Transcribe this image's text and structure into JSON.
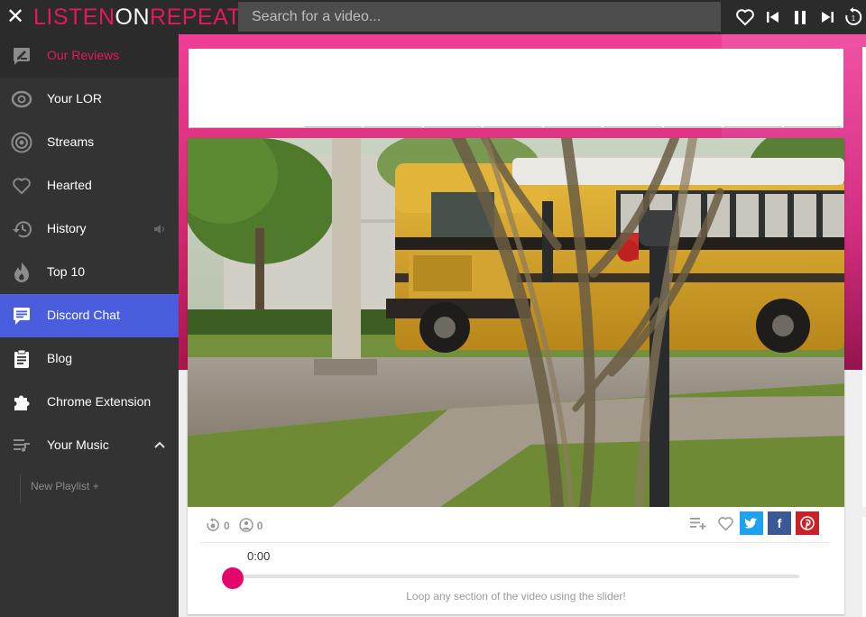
{
  "app": {
    "logo_left": "LISTEN",
    "logo_on": "ON",
    "logo_right": "REPEAT",
    "close_icon": "close-icon",
    "brand_color": "#e4185c"
  },
  "search": {
    "placeholder": "Search for a video..."
  },
  "toolbar": {
    "icons": [
      "heart-icon",
      "skip-previous-icon",
      "pause-icon",
      "skip-next-icon",
      "replay-icon"
    ],
    "replay_badge": "1"
  },
  "sidebar": {
    "items": [
      {
        "label": "Our Reviews",
        "icon": "rate-review-icon",
        "active": true
      },
      {
        "label": "Your LOR",
        "icon": "lor-logo-icon"
      },
      {
        "label": "Streams",
        "icon": "streams-icon"
      },
      {
        "label": "Hearted",
        "icon": "heart-icon"
      },
      {
        "label": "History",
        "icon": "history-icon",
        "extra": "volume-icon"
      },
      {
        "label": "Top 10",
        "icon": "flame-icon"
      },
      {
        "label": "Discord Chat",
        "icon": "chat-icon",
        "highlight_color": "#4a5ddc"
      },
      {
        "label": "Blog",
        "icon": "clipboard-icon"
      },
      {
        "label": "Chrome Extension",
        "icon": "puzzle-icon"
      },
      {
        "label": "Your Music",
        "icon": "queue-music-icon",
        "extra": "chevron-up-icon"
      }
    ],
    "new_playlist": "New Playlist +"
  },
  "player": {
    "video_description": "school-bus-video-frame",
    "repeat_count": "0",
    "listener_count": "0",
    "time": "0:00",
    "slider_position": 0,
    "hint": "Loop any section of the video using the slider!",
    "accent": "#e5066b"
  },
  "share": {
    "twitter_color": "#1da1f2",
    "facebook_color": "#3b5998",
    "pinterest_color": "#cb2027"
  }
}
